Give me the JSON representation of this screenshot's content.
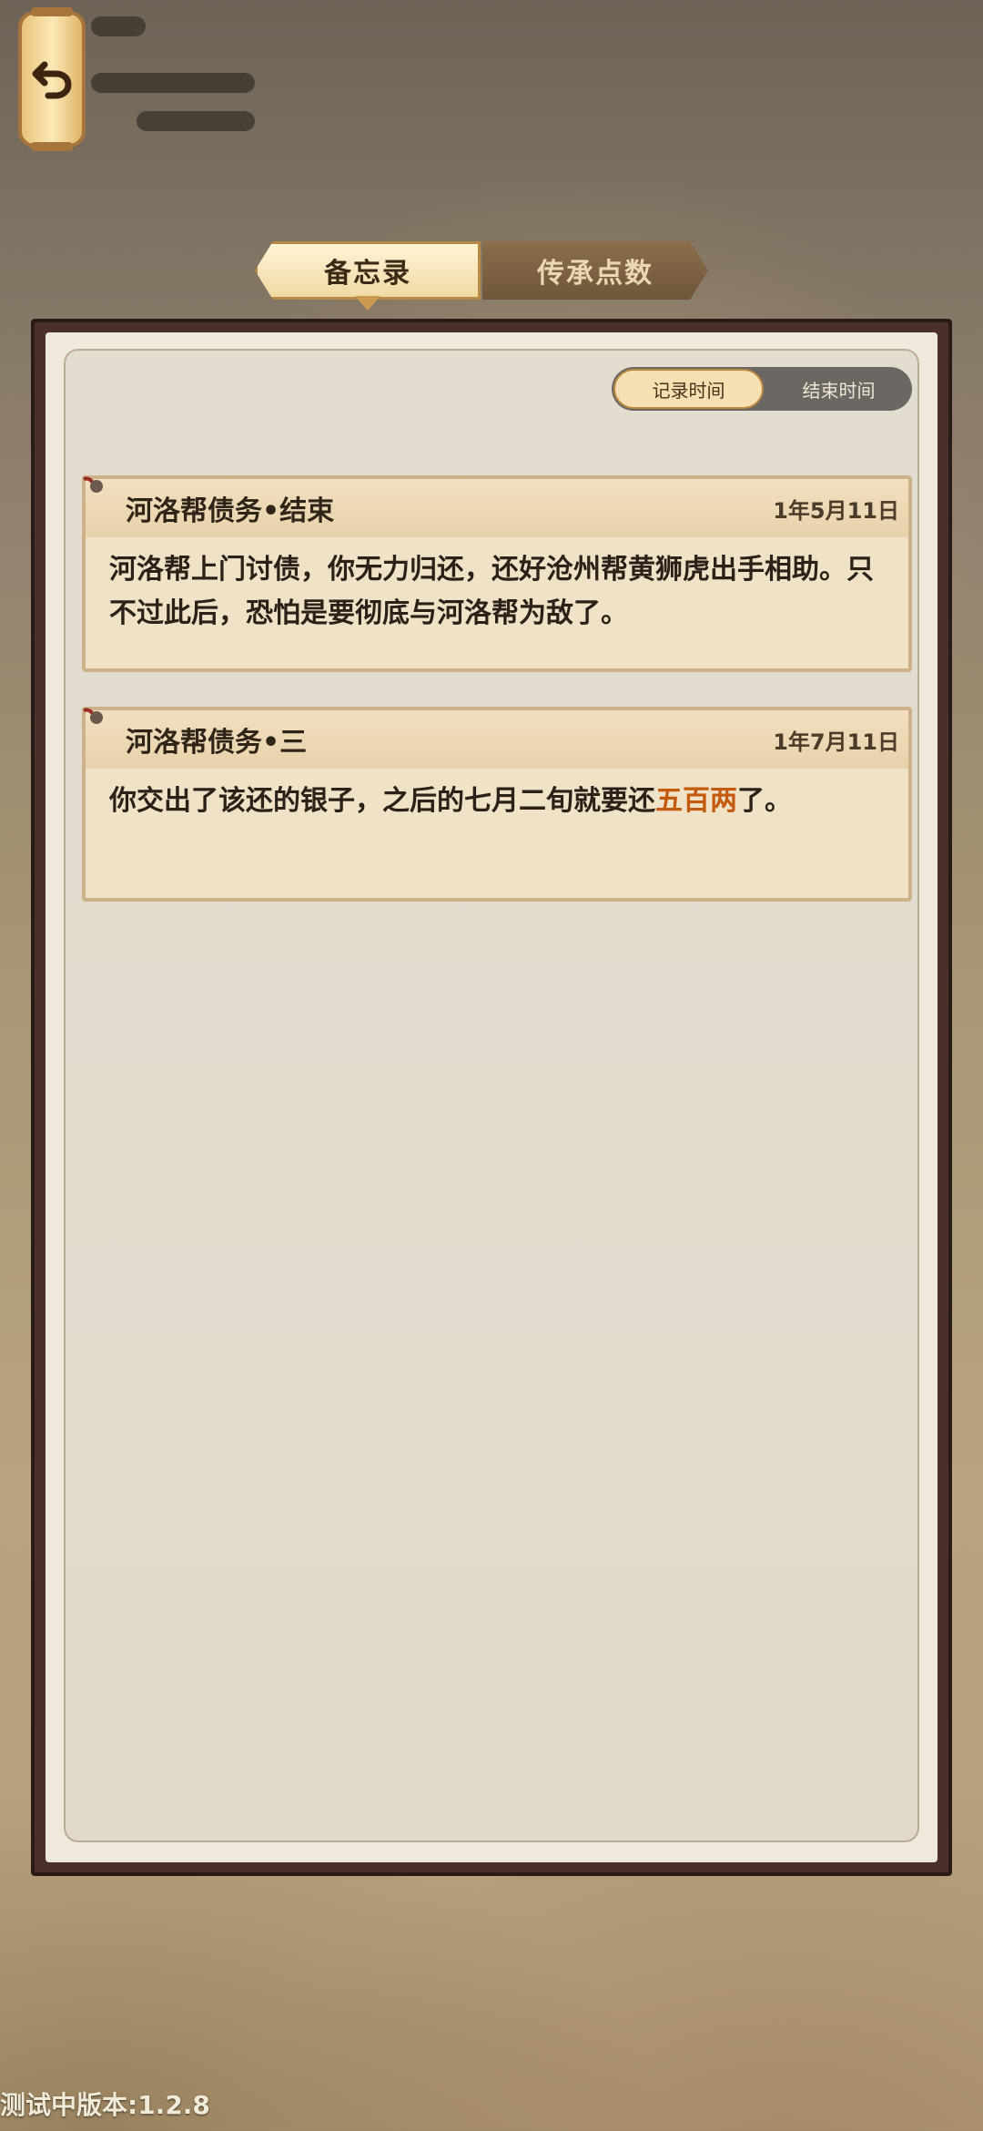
{
  "tabs": {
    "memo": "备忘录",
    "legacy_points": "传承点数"
  },
  "sort": {
    "record_time": "记录时间",
    "end_time": "结束时间"
  },
  "memos": [
    {
      "title": "河洛帮债务•结束",
      "date": "1年5月11日",
      "body": "河洛帮上门讨债，你无力归还，还好沧州帮黄狮虎出手相助。只不过此后，恐怕是要彻底与河洛帮为敌了。"
    },
    {
      "title": "河洛帮债务•三",
      "date": "1年7月11日",
      "body_prefix": "你交出了该还的银子，之后的七月二旬就要还",
      "body_highlight": "五百两",
      "body_suffix": "了。"
    }
  ],
  "version": "测试中版本:1.2.8",
  "icons": {
    "back": "back-arrow-icon",
    "pin": "pin-icon"
  },
  "colors": {
    "highlight": "#c35a0e",
    "frame": "#4a2f2a"
  }
}
